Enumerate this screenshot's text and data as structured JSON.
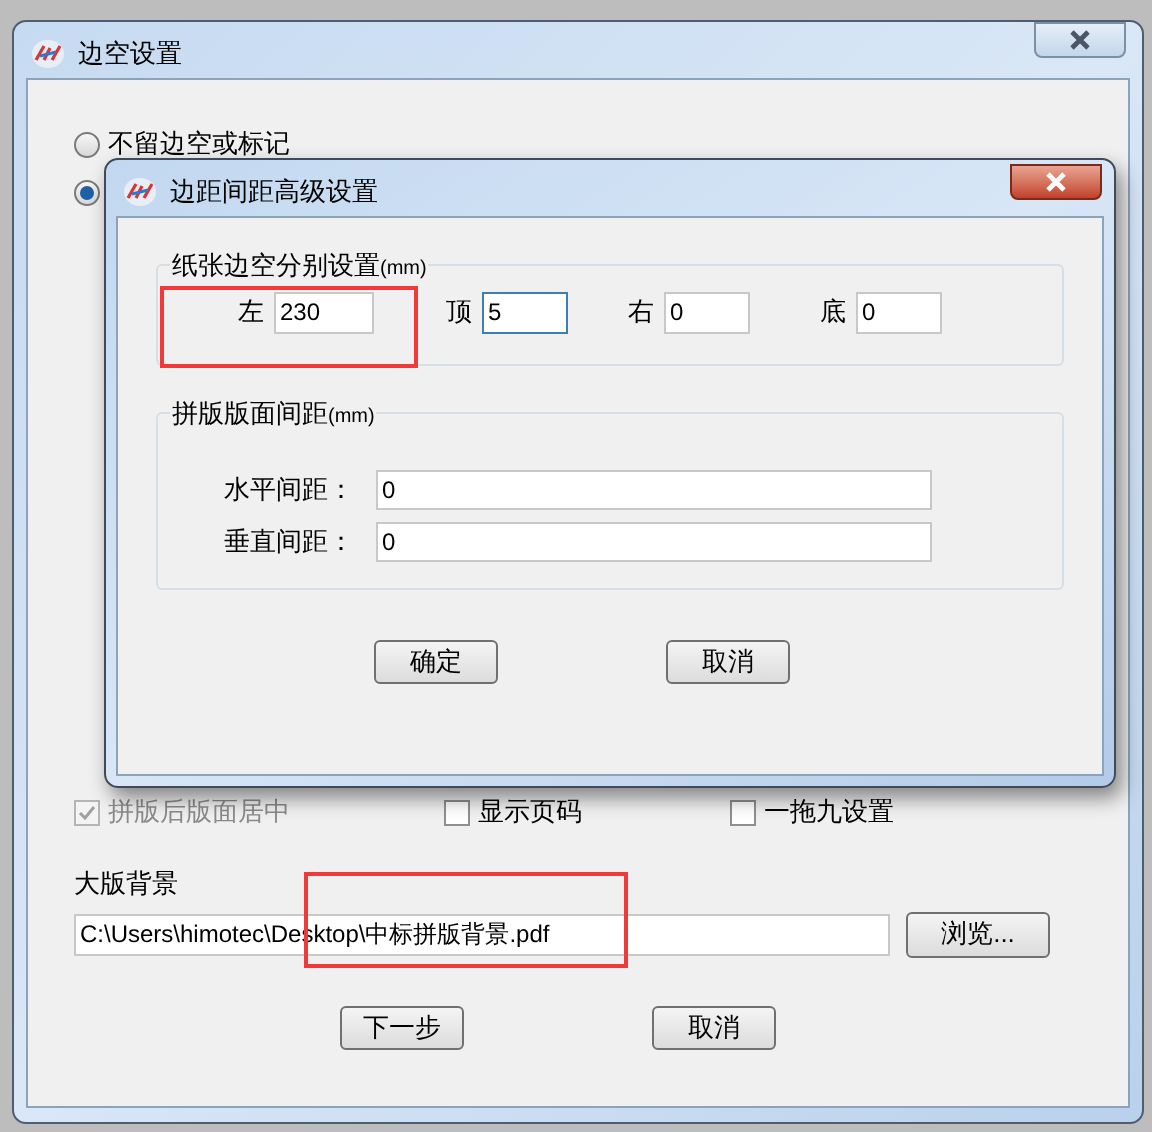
{
  "window": {
    "title": "边空设置"
  },
  "margin_options": [
    {
      "label": "不留边空或标记",
      "selected": false
    },
    {
      "selected": true
    }
  ],
  "options": [
    {
      "label": "拼版后版面居中",
      "checked": true,
      "disabled": true
    },
    {
      "label": "显示页码",
      "checked": false,
      "disabled": false
    },
    {
      "label": "一拖九设置",
      "checked": false,
      "disabled": false
    }
  ],
  "background": {
    "label": "大版背景",
    "path": "C:\\Users\\himotec\\Desktop\\中标拼版背景.pdf",
    "browse_button": "浏览..."
  },
  "buttons": [
    "下一步",
    "取消"
  ],
  "dialog": {
    "title": "边距间距高级设置",
    "paper_margins": {
      "legend": "纸张边空分别设置",
      "unit": "(mm)",
      "fields": [
        {
          "label": "左",
          "value": "230",
          "focused": false
        },
        {
          "label": "顶",
          "value": "5",
          "focused": true
        },
        {
          "label": "右",
          "value": "0",
          "focused": false
        },
        {
          "label": "底",
          "value": "0",
          "focused": false
        }
      ]
    },
    "spacing": {
      "legend": "拼版版面间距",
      "unit": "(mm)",
      "fields": [
        {
          "label": "水平间距：",
          "value": "0"
        },
        {
          "label": "垂直间距：",
          "value": "0"
        }
      ]
    },
    "buttons": [
      "确定",
      "取消"
    ]
  }
}
